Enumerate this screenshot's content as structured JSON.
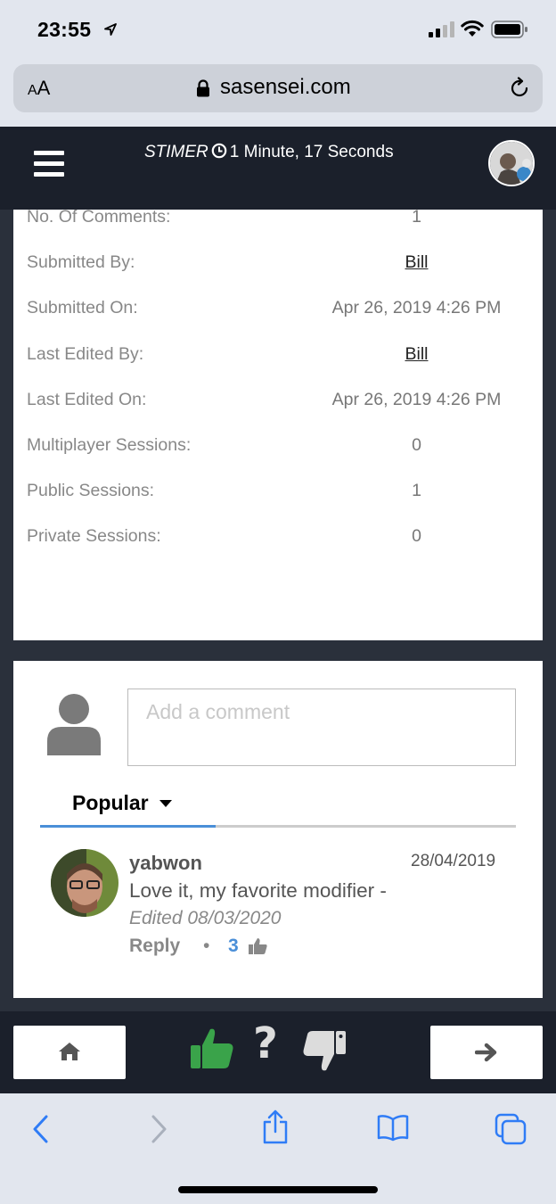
{
  "status_bar": {
    "time": "23:55"
  },
  "browser": {
    "text_size_label_small": "A",
    "text_size_label_big": "A",
    "url": "sasensei.com"
  },
  "app_header": {
    "timer_label": "STIMER",
    "timer_value": "1 Minute, 17 Seconds"
  },
  "details": {
    "rows": [
      {
        "label": "No. Of Comments:",
        "value": "1"
      },
      {
        "label": "Submitted By:",
        "value": "Bill"
      },
      {
        "label": "Submitted On:",
        "value": "Apr 26, 2019 4:26 PM"
      },
      {
        "label": "Last Edited By:",
        "value": "Bill"
      },
      {
        "label": "Last Edited On:",
        "value": "Apr 26, 2019 4:26 PM"
      },
      {
        "label": "Multiplayer Sessions:",
        "value": "0"
      },
      {
        "label": "Public Sessions:",
        "value": "1"
      },
      {
        "label": "Private Sessions:",
        "value": "0"
      }
    ]
  },
  "comments": {
    "input_placeholder": "Add a comment",
    "sort_label": "Popular",
    "items": [
      {
        "author": "yabwon",
        "date": "28/04/2019",
        "text": "Love it, my favorite modifier -",
        "edited": "Edited 08/03/2020",
        "reply_label": "Reply",
        "separator": "•",
        "votes": "3"
      }
    ]
  },
  "bottom_bar": {
    "question_glyph": "?"
  },
  "colors": {
    "nav_dark": "#1b202b",
    "accent_blue": "#4a8fd8",
    "thumb_up_green": "#3aa34a",
    "ios_blue": "#2f7cf6"
  }
}
